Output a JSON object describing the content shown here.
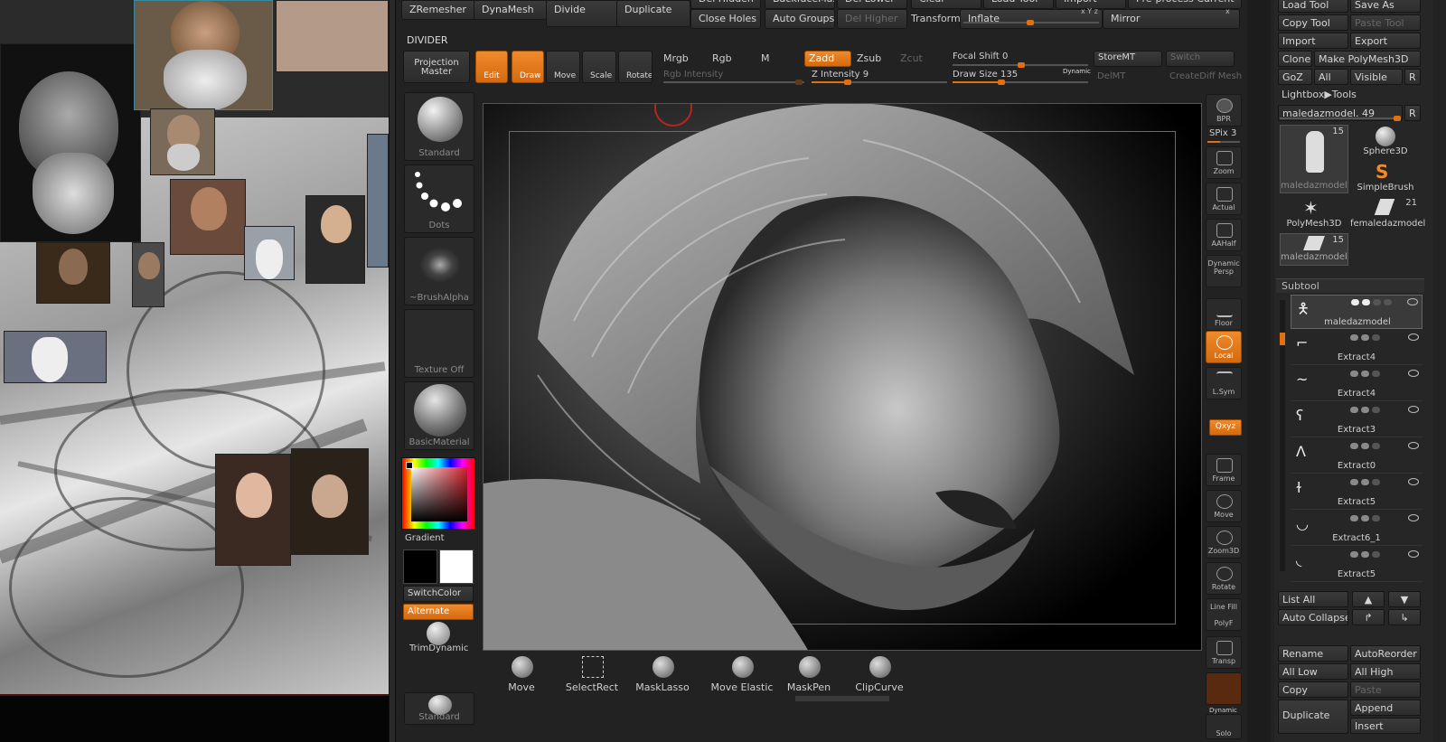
{
  "top_menu": {
    "zremesher": "ZRemesher",
    "dynamesh": "DynaMesh",
    "divide": "Divide",
    "duplicate": "Duplicate",
    "del_hidden": "Del Hidden",
    "backface_mask": "BackfaceMask",
    "del_lower": "Del Lower",
    "clear": "Clear",
    "load_tool_top": "Load Tool",
    "import_top": "Import",
    "preprocess_current": "Pre-process Current",
    "close_holes": "Close Holes",
    "auto_groups": "Auto Groups",
    "del_higher": "Del Higher",
    "transform": "Transform",
    "inflate": "Inflate",
    "xyz_mini": "x Y z",
    "mirror": "Mirror",
    "mirror_mini": "x"
  },
  "divider_label": "DIVIDER",
  "draw_bar": {
    "projection_master": "Projection Master",
    "edit": "Edit",
    "draw": "Draw",
    "move": "Move",
    "scale": "Scale",
    "rotate": "Rotate",
    "mrgb": "Mrgb",
    "rgb": "Rgb",
    "m": "M",
    "zadd": "Zadd",
    "zsub": "Zsub",
    "zcut": "Zcut",
    "rgb_intensity": "Rgb Intensity",
    "z_intensity": "Z Intensity 9",
    "focal_shift": "Focal Shift 0",
    "draw_size": "Draw Size 135",
    "dynamic": "Dynamic",
    "storemt": "StoreMT",
    "switch": "Switch",
    "delmt": "DelMT",
    "creatediff_mesh": "CreateDiff Mesh",
    "values": {
      "z_intensity": 9,
      "focal_shift": 0,
      "draw_size": 135
    }
  },
  "left_tools": {
    "standard": "Standard",
    "dots": "Dots",
    "brush_alpha": "~BrushAlpha",
    "texture_off": "Texture Off",
    "basic_material": "BasicMaterial",
    "gradient": "Gradient",
    "switch_color": "SwitchColor",
    "alternate": "Alternate",
    "trim_dynamic": "TrimDynamic",
    "standard_bottom": "Standard"
  },
  "right_shelf": {
    "bpr": "BPR",
    "spix": "SPix 3",
    "zoom": "Zoom",
    "actual": "Actual",
    "aahalf": "AAHalf",
    "dynamic": "Dynamic",
    "persp": "Persp",
    "floor": "Floor",
    "local": "Local",
    "lsym": "L.Sym",
    "xyz": "Qxyz",
    "frame": "Frame",
    "move": "Move",
    "zoom3d": "Zoom3D",
    "rotate": "Rotate",
    "line_fill": "Line Fill",
    "polyf": "PolyF",
    "transp": "Transp",
    "dynamic2": "Dynamic",
    "solo": "Solo"
  },
  "bottom_brushes": [
    "Move",
    "SelectRect",
    "MaskLasso",
    "Move Elastic",
    "MaskPen",
    "ClipCurve"
  ],
  "tool_palette": {
    "load_tool": "Load Tool",
    "save_as": "Save As",
    "copy_tool": "Copy Tool",
    "paste_tool": "Paste Tool",
    "import": "Import",
    "export": "Export",
    "clone": "Clone",
    "make_polymesh": "Make PolyMesh3D",
    "goz": "GoZ",
    "all": "All",
    "visible": "Visible",
    "r": "R",
    "lightbox_tools": "Lightbox▶Tools",
    "current_tool": "maledazmodel. 49",
    "r2": "R",
    "thumbs": [
      {
        "name": "maledazmodel",
        "count": "15"
      },
      {
        "name": "Sphere3D",
        "count": ""
      },
      {
        "name": "SimpleBrush",
        "count": ""
      },
      {
        "name": "PolyMesh3D",
        "count": ""
      },
      {
        "name": "femaledazmodel",
        "count": "21"
      },
      {
        "name": "maledazmodel",
        "count": "15"
      }
    ]
  },
  "subtool": {
    "title": "Subtool",
    "items": [
      "maledazmodel",
      "Extract4",
      "Extract4",
      "Extract3",
      "Extract0",
      "Extract5",
      "Extract6_1",
      "Extract5"
    ],
    "list_all": "List All",
    "auto_collapse": "Auto Collapse",
    "rename": "Rename",
    "auto_reorder": "AutoReorder",
    "all_low": "All Low",
    "all_high": "All High",
    "copy": "Copy",
    "paste": "Paste",
    "duplicate": "Duplicate",
    "append": "Append",
    "insert": "Insert"
  },
  "colors": {
    "accent": "#e8761a",
    "panel": "#262626",
    "button": "#333333"
  }
}
